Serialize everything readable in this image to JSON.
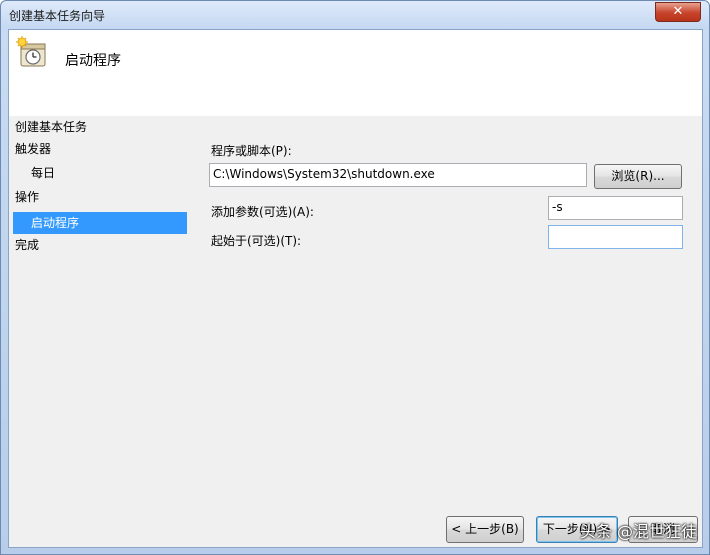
{
  "window": {
    "title": "创建基本任务向导",
    "close_glyph": "✕"
  },
  "header": {
    "title": "启动程序",
    "icon": "task-clock-icon"
  },
  "steps": [
    {
      "label": "创建基本任务",
      "selected": false
    },
    {
      "label": "触发器",
      "selected": false
    },
    {
      "label": "每日",
      "selected": false
    },
    {
      "label": "操作",
      "selected": false
    },
    {
      "label": "启动程序",
      "selected": true
    },
    {
      "label": "完成",
      "selected": false
    }
  ],
  "form": {
    "program_label": "程序或脚本(P):",
    "program_value": "C:\\Windows\\System32\\shutdown.exe",
    "browse_label": "浏览(R)...",
    "args_label": "添加参数(可选)(A):",
    "args_value": "-s",
    "startin_label": "起始于(可选)(T):",
    "startin_value": ""
  },
  "footer": {
    "back_label": "< 上一步(B)",
    "next_label": "下一步(N) >",
    "cancel_label": "取消"
  },
  "watermark": "头条 @混世狂徒",
  "colors": {
    "selection": "#3399ff",
    "client_bg": "#f0f0f0"
  }
}
